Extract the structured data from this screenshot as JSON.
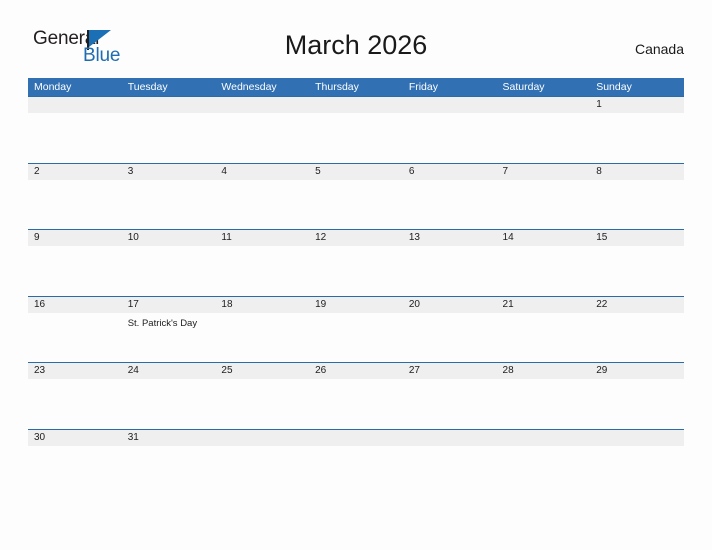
{
  "logo": {
    "word_top": "General",
    "word_bottom": "Blue",
    "triangle_icon": "triangle-icon",
    "brand_blue": "#1f6cb0",
    "brand_dark": "#231f20"
  },
  "header": {
    "title": "March 2026",
    "country": "Canada"
  },
  "colors": {
    "header_blue": "#3070b3",
    "rule_blue": "#2a6ca8",
    "band_gray": "#efefef",
    "page_bg": "#fdfdfd",
    "text": "#202020"
  },
  "calendar": {
    "weekdays": [
      "Monday",
      "Tuesday",
      "Wednesday",
      "Thursday",
      "Friday",
      "Saturday",
      "Sunday"
    ],
    "weeks": [
      [
        {
          "day": "",
          "event": ""
        },
        {
          "day": "",
          "event": ""
        },
        {
          "day": "",
          "event": ""
        },
        {
          "day": "",
          "event": ""
        },
        {
          "day": "",
          "event": ""
        },
        {
          "day": "",
          "event": ""
        },
        {
          "day": "1",
          "event": ""
        }
      ],
      [
        {
          "day": "2",
          "event": ""
        },
        {
          "day": "3",
          "event": ""
        },
        {
          "day": "4",
          "event": ""
        },
        {
          "day": "5",
          "event": ""
        },
        {
          "day": "6",
          "event": ""
        },
        {
          "day": "7",
          "event": ""
        },
        {
          "day": "8",
          "event": ""
        }
      ],
      [
        {
          "day": "9",
          "event": ""
        },
        {
          "day": "10",
          "event": ""
        },
        {
          "day": "11",
          "event": ""
        },
        {
          "day": "12",
          "event": ""
        },
        {
          "day": "13",
          "event": ""
        },
        {
          "day": "14",
          "event": ""
        },
        {
          "day": "15",
          "event": ""
        }
      ],
      [
        {
          "day": "16",
          "event": ""
        },
        {
          "day": "17",
          "event": "St. Patrick's Day"
        },
        {
          "day": "18",
          "event": ""
        },
        {
          "day": "19",
          "event": ""
        },
        {
          "day": "20",
          "event": ""
        },
        {
          "day": "21",
          "event": ""
        },
        {
          "day": "22",
          "event": ""
        }
      ],
      [
        {
          "day": "23",
          "event": ""
        },
        {
          "day": "24",
          "event": ""
        },
        {
          "day": "25",
          "event": ""
        },
        {
          "day": "26",
          "event": ""
        },
        {
          "day": "27",
          "event": ""
        },
        {
          "day": "28",
          "event": ""
        },
        {
          "day": "29",
          "event": ""
        }
      ],
      [
        {
          "day": "30",
          "event": ""
        },
        {
          "day": "31",
          "event": ""
        },
        {
          "day": "",
          "event": ""
        },
        {
          "day": "",
          "event": ""
        },
        {
          "day": "",
          "event": ""
        },
        {
          "day": "",
          "event": ""
        },
        {
          "day": "",
          "event": ""
        }
      ]
    ]
  }
}
